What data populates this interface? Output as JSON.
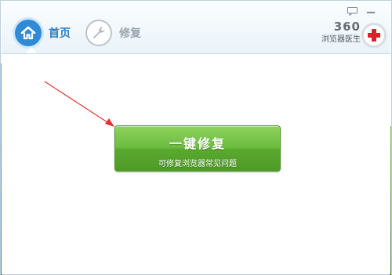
{
  "header": {
    "nav": [
      {
        "label": "首页",
        "icon": "home-icon",
        "active": true
      },
      {
        "label": "修复",
        "icon": "wrench-icon",
        "active": false
      }
    ],
    "brand": {
      "number": "360",
      "name": "浏览器医生",
      "badge_icon": "red-cross-icon"
    },
    "controls": {
      "feedback_icon": "message-icon",
      "minimize_icon": "minimize-icon"
    }
  },
  "main": {
    "fix_button": {
      "title": "一键修复",
      "subtitle": "可修复浏览器常见问题"
    }
  },
  "annotation": {
    "arrow_color": "#e0322c"
  },
  "colors": {
    "accent": "#2f8bd6",
    "button_green": "#6cbc3f",
    "cross_red": "#d9222a"
  }
}
